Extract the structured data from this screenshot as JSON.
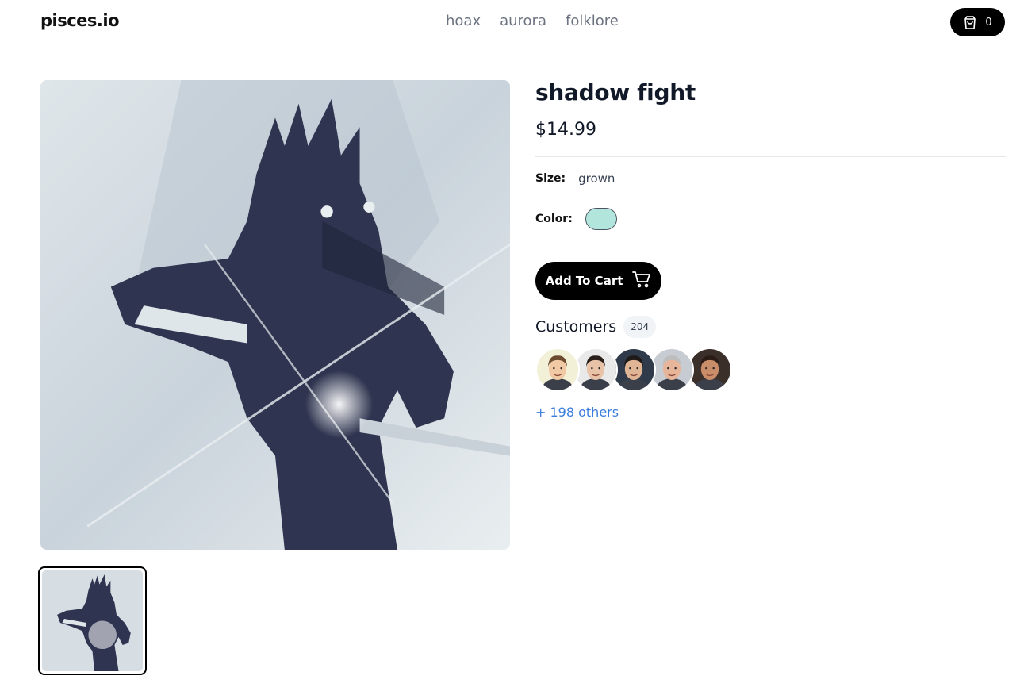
{
  "header": {
    "logo": "pisces.io",
    "nav": [
      "hoax",
      "aurora",
      "folklore"
    ],
    "cart_count": "0"
  },
  "product": {
    "title": "shadow fight",
    "price": "$14.99",
    "size_label": "Size:",
    "size_value": "grown",
    "color_label": "Color:",
    "color_value": "#b2e6dc",
    "add_to_cart": "Add To Cart"
  },
  "customers": {
    "label": "Customers",
    "count": "204",
    "others": "+ 198 others",
    "avatars": [
      {
        "skin": "#f2c9a5",
        "hair": "#6b4a2e",
        "bg": "#f3f0d8"
      },
      {
        "skin": "#e8c3a8",
        "hair": "#2a1f1a",
        "bg": "#e9e9e9"
      },
      {
        "skin": "#e0b596",
        "hair": "#1f1a17",
        "bg": "#2f3a4a"
      },
      {
        "skin": "#e6b59a",
        "hair": "#bdbdbd",
        "bg": "#c7ccd2"
      },
      {
        "skin": "#c98d6a",
        "hair": "#2b1d16",
        "bg": "#3b2f2a"
      }
    ]
  },
  "colors": {
    "accent_link": "#3b7ddd",
    "button_bg": "#000000"
  },
  "icons": [
    "shopping-bag-icon",
    "shopping-cart-icon"
  ]
}
